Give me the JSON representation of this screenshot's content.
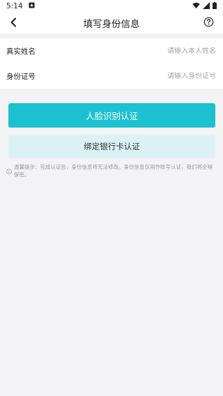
{
  "status_bar": {
    "time": "5:14"
  },
  "header": {
    "title": "填写身份信息"
  },
  "form": {
    "name_label": "真实姓名",
    "name_placeholder": "请输入本人姓名",
    "name_value": "",
    "id_label": "身份证号",
    "id_placeholder": "请输入身份证号",
    "id_value": ""
  },
  "buttons": {
    "face_auth_label": "人脸识别认证",
    "bank_card_label": "绑定银行卡认证"
  },
  "tip": {
    "text": "温馨提示：完成认证后，身份信息将无法修改。身份信息仅用作账号认证，我们将全程保密。"
  },
  "colors": {
    "accent": "#1cc1d0",
    "secondary_button_bg": "#dcf1f4",
    "page_bg": "#f3f3f5"
  },
  "icons": [
    "notification-icon",
    "wifi-icon",
    "signal-icon",
    "battery-icon",
    "back-arrow-icon",
    "help-icon",
    "info-icon"
  ]
}
